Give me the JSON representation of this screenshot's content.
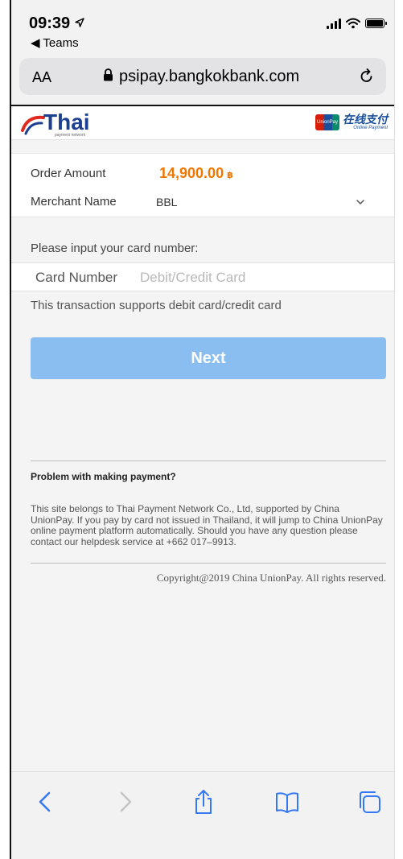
{
  "status_bar": {
    "time": "09:39",
    "back_label": "◀ Teams"
  },
  "safari": {
    "text_size_label": "AA",
    "url": "psipay.bangkokbank.com"
  },
  "header": {
    "thai_logo_text": "Thai",
    "thai_logo_sub": "payment network",
    "unionpay_card_text": "UnionPay",
    "unionpay_cn": "在线支付",
    "unionpay_en": "Online Payment"
  },
  "order": {
    "amount_label": "Order Amount",
    "amount_value": "14,900.00",
    "currency_symbol": "฿",
    "merchant_label": "Merchant Name",
    "merchant_value": "BBL"
  },
  "card": {
    "prompt": "Please input your card number:",
    "label": "Card Number",
    "placeholder": "Debit/Credit Card",
    "support_text": "This transaction supports debit card/credit card"
  },
  "next_button": "Next",
  "footer": {
    "problem_heading": "Problem with making payment?",
    "info_text": "This site belongs to Thai Payment Network Co., Ltd, supported by China UnionPay. If you pay by card not issued in Thailand, it will jump to China UnionPay online payment platform automatically. Should you have any question please contact our helpdesk service at +662 017–9913.",
    "copyright": "Copyright@2019 China UnionPay. All rights reserved."
  },
  "colors": {
    "accent_orange": "#f07800",
    "next_button_bg": "#8bbef0",
    "ios_blue": "#3478f6",
    "thai_blue": "#1d3f8f"
  }
}
